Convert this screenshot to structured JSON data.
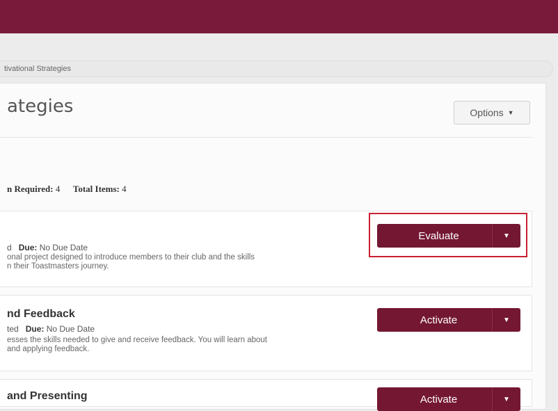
{
  "breadcrumb": {
    "text": "tivational Strategies"
  },
  "header": {
    "title": "ategies",
    "options_label": "Options"
  },
  "summary": {
    "required_label": "Required:",
    "required_value": "4",
    "total_label": "Total Items:",
    "total_value": "4",
    "prefix": "n"
  },
  "items": [
    {
      "title": "",
      "status_prefix": "d",
      "due_label": "Due:",
      "due_value": "No Due Date",
      "desc_line1": "onal project designed to introduce members to their club and the skills",
      "desc_line2": "n their Toastmasters journey.",
      "action_label": "Evaluate"
    },
    {
      "title": "nd Feedback",
      "status_prefix": "ted",
      "due_label": "Due:",
      "due_value": "No Due Date",
      "desc_line1": "esses the skills needed to give and receive feedback. You will learn about",
      "desc_line2": "and applying feedback.",
      "action_label": "Activate"
    },
    {
      "title": "and Presenting",
      "action_label": "Activate"
    }
  ],
  "colors": {
    "brand": "#7a1a3a",
    "highlight": "#c8202f"
  }
}
